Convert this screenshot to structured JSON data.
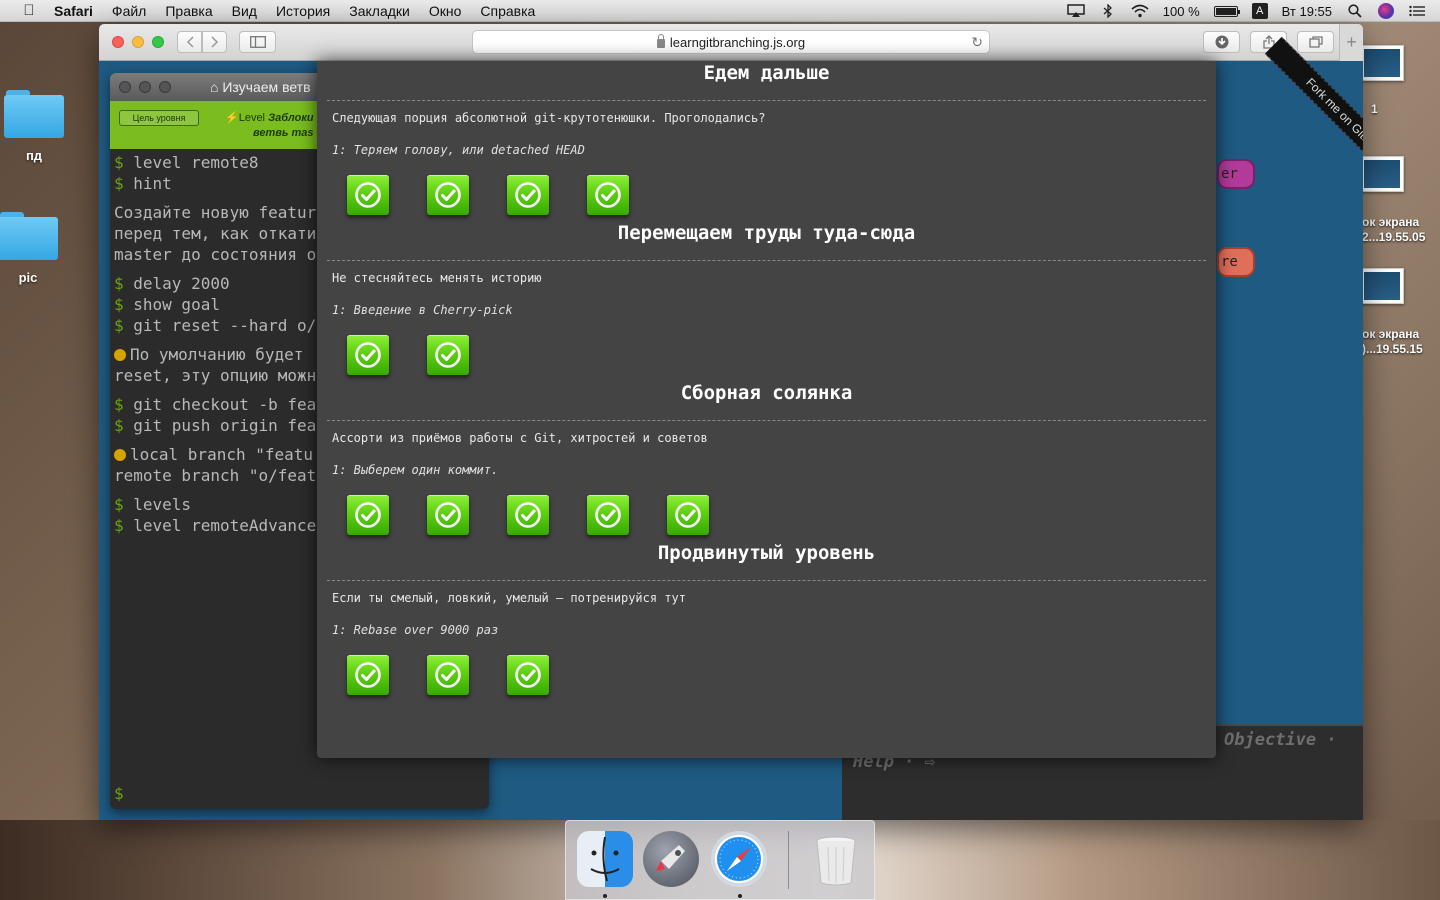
{
  "menubar": {
    "app_name": "Safari",
    "items": [
      "Файл",
      "Правка",
      "Вид",
      "История",
      "Закладки",
      "Окно",
      "Справка"
    ],
    "battery": "100 %",
    "input_source": "A",
    "clock": "Вт 19:55"
  },
  "desktop": {
    "folder1": "пд",
    "folder2": "pic",
    "thumb1_label": "1",
    "thumb2_label_1": "ок экрана",
    "thumb2_label_2": "2...19.55.05",
    "thumb3_label_1": "ок экрана",
    "thumb3_label_2": ")...19.55.15"
  },
  "browser": {
    "url": "learngitbranching.js.org"
  },
  "terminal": {
    "title": "Изучаем ветв",
    "goal_button": "Цель уровня",
    "goal_text_prefix": "Level ",
    "goal_text_em": "Заблоки",
    "goal_text_line2": "ветвь mas",
    "lines": [
      "level remote8",
      "hint",
      "Создайте новую featur",
      "перед тем, как откати",
      "master до состояния о",
      "delay 2000",
      "show goal",
      "git reset --hard o/",
      "По умолчанию будет ",
      "reset, эту опцию можн",
      "git checkout -b fea",
      "git push origin fea",
      "local branch \"featu",
      "remote branch \"o/feat",
      "levels",
      "level remoteAdvance"
    ],
    "prompt": "$"
  },
  "background": {
    "fork_ribbon": "Fork me on GitHub",
    "pill1": "er",
    "pill2": "re",
    "objective": "Objective ·",
    "help": "Help · ⇨"
  },
  "modal": {
    "sections": [
      {
        "title": "",
        "description": "",
        "subtitle": "",
        "levels": 4
      },
      {
        "title": "Едем дальше",
        "description": "Следующая порция абсолютной git-крутотенюшки. Проголодались?",
        "subtitle": "1: Теряем голову, или detached HEAD",
        "levels": 4
      },
      {
        "title": "Перемещаем труды туда-сюда",
        "description": "Не стесняйтесь менять историю",
        "subtitle": "1: Введение в Cherry-pick",
        "levels": 2
      },
      {
        "title": "Сборная солянка",
        "description": "Ассорти из приёмов работы с Git, хитростей и советов",
        "subtitle": "1: Выберем один коммит.",
        "levels": 5
      },
      {
        "title": "Продвинутый уровень",
        "description": "Если ты смелый, ловкий, умелый – потренируйся тут",
        "subtitle": "1: Rebase over 9000 раз",
        "levels": 3
      }
    ]
  },
  "dock": {
    "apps": [
      "finder-icon",
      "launchpad-icon",
      "safari-icon",
      "trash-icon"
    ]
  }
}
